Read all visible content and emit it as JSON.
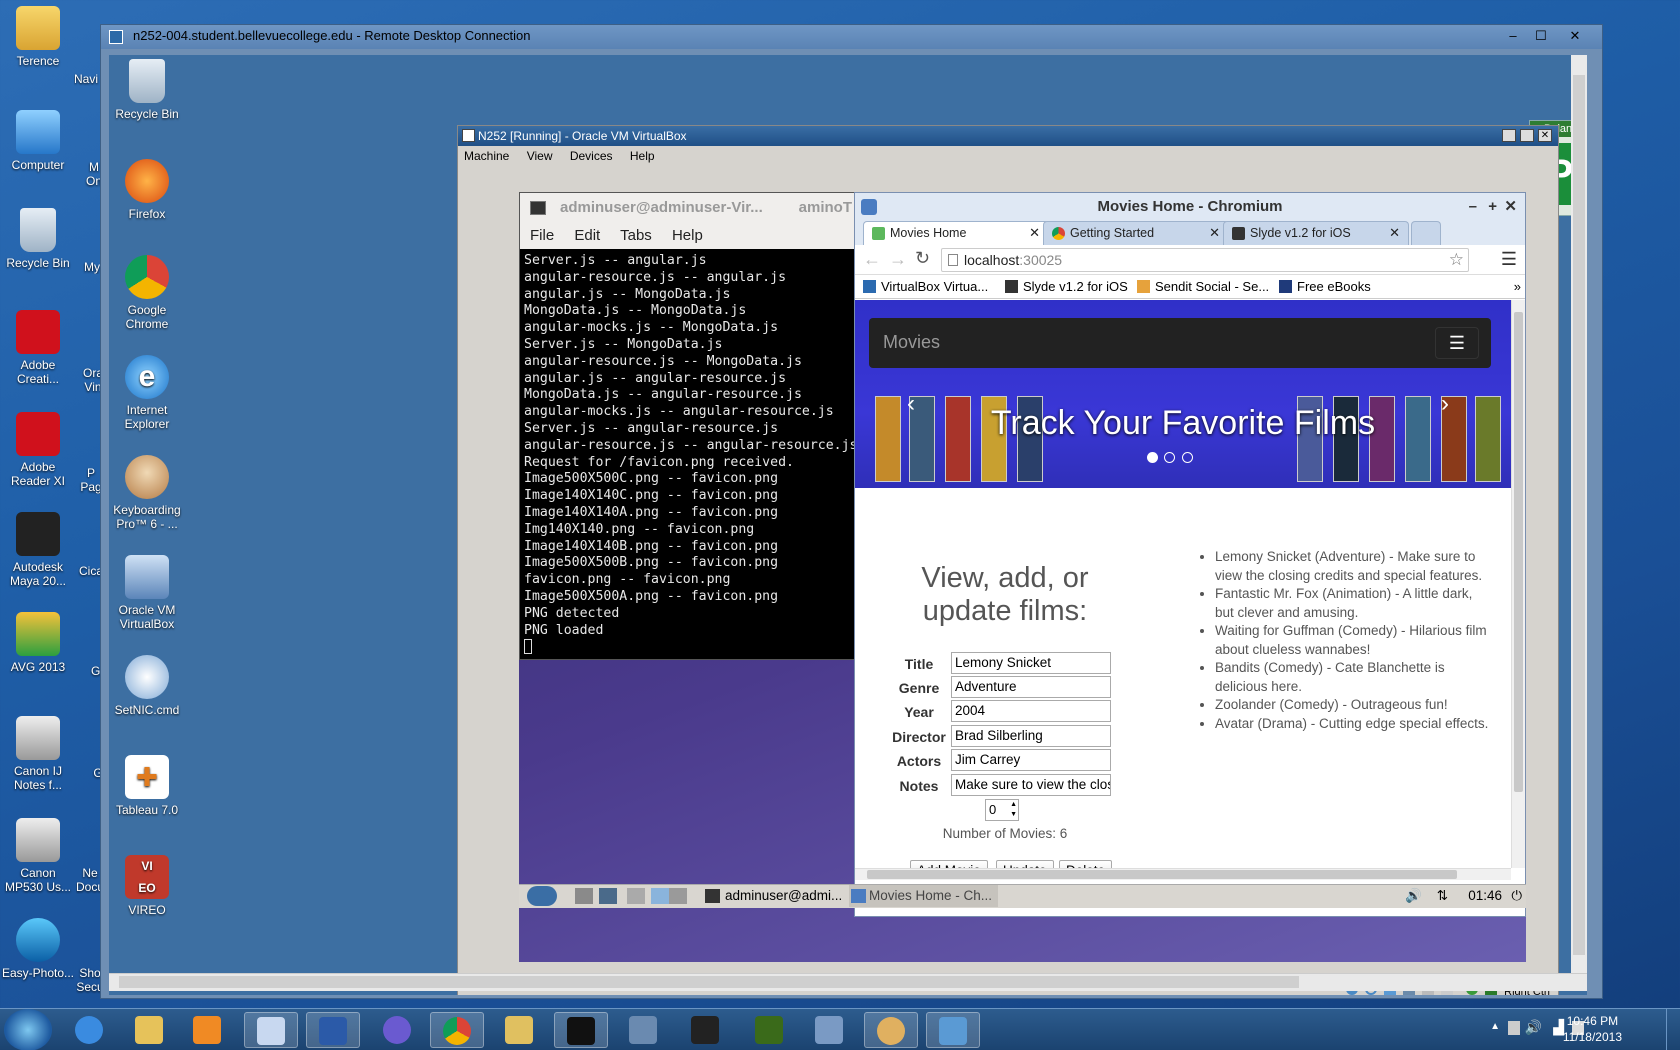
{
  "desktop_icons": [
    {
      "label": "Terence",
      "icon": "user-folder-icon"
    },
    {
      "label": "Computer",
      "icon": "computer-icon"
    },
    {
      "label": "Recycle Bin",
      "icon": "recycle-bin-icon"
    },
    {
      "label": "Adobe Creati...",
      "icon": "adobe-cc-icon"
    },
    {
      "label": "Adobe Reader XI",
      "icon": "adobe-reader-icon"
    },
    {
      "label": "Autodesk Maya 20...",
      "icon": "maya-icon"
    },
    {
      "label": "AVG 2013",
      "icon": "avg-icon"
    },
    {
      "label": "Canon IJ Notes f...",
      "icon": "canon-notes-icon"
    },
    {
      "label": "Canon MP530 Us...",
      "icon": "canon-printer-icon"
    },
    {
      "label": "Easy-Photo...",
      "icon": "easy-photo-icon"
    }
  ],
  "partial_icons": [
    "Navi",
    "M On",
    "My",
    "Ora Vin",
    "P Pag",
    "Cica",
    "Gi",
    "G",
    "Ne Docu",
    "Sho Secu"
  ],
  "remote_icons": [
    {
      "label": "Recycle Bin",
      "icon": "recycle-bin-icon"
    },
    {
      "label": "Firefox",
      "icon": "firefox-icon"
    },
    {
      "label": "Google Chrome",
      "icon": "chrome-icon"
    },
    {
      "label": "Internet Explorer",
      "icon": "ie-icon"
    },
    {
      "label": "Keyboarding Pro™ 6 - ...",
      "icon": "keyboarding-icon"
    },
    {
      "label": "Oracle VM VirtualBox",
      "icon": "virtualbox-icon"
    },
    {
      "label": "SetNIC.cmd",
      "icon": "cmd-icon"
    },
    {
      "label": "Tableau 7.0",
      "icon": "tableau-icon"
    },
    {
      "label": "VIREO",
      "icon": "vireo-icon"
    }
  ],
  "rdp": {
    "title": "n252-004.student.bellevuecollege.edu - Remote Desktop Connection"
  },
  "side_panel": {
    "label": "Balanc"
  },
  "vbox": {
    "title": "N252 [Running] - Oracle VM VirtualBox",
    "menu": [
      "Machine",
      "View",
      "Devices",
      "Help"
    ],
    "status_text": "Right Ctrl"
  },
  "terminal": {
    "title": "adminuser@adminuser-Vir...",
    "title_tail": "aminoT",
    "menu": [
      "File",
      "Edit",
      "Tabs",
      "Help"
    ],
    "lines": [
      "Server.js -- angular.js",
      "angular-resource.js -- angular.js",
      "angular.js -- MongoData.js",
      "MongoData.js -- MongoData.js",
      "angular-mocks.js -- MongoData.js",
      "Server.js -- MongoData.js",
      "angular-resource.js -- MongoData.js",
      "angular.js -- angular-resource.js",
      "MongoData.js -- angular-resource.js",
      "angular-mocks.js -- angular-resource.js",
      "Server.js -- angular-resource.js",
      "angular-resource.js -- angular-resource.js",
      "Request for /favicon.png received.",
      "Image500X500C.png -- favicon.png",
      "Image140X140C.png -- favicon.png",
      "Image140X140A.png -- favicon.png",
      "Img140X140.png -- favicon.png",
      "Image140X140B.png -- favicon.png",
      "Image500X500B.png -- favicon.png",
      "favicon.png -- favicon.png",
      "Image500X500A.png -- favicon.png",
      "PNG detected",
      "PNG loaded"
    ]
  },
  "chromium": {
    "title": "Movies Home - Chromium",
    "tabs": [
      {
        "label": "Movies Home",
        "active": true
      },
      {
        "label": "Getting Started",
        "active": false
      },
      {
        "label": "Slyde v1.2 for iOS",
        "active": false
      }
    ],
    "address": "localhost",
    "port": ":30025",
    "bookmarks": [
      "VirtualBox Virtua...",
      "Slyde v1.2 for iOS",
      "Sendit Social - Se...",
      "Free eBooks"
    ],
    "bookmarks_more": "»"
  },
  "movies_page": {
    "brand": "Movies",
    "carousel_caption": "Track Your Favorite Films",
    "form_heading": "View, add, or update films:",
    "fields": [
      {
        "label": "Title",
        "value": "Lemony Snicket"
      },
      {
        "label": "Genre",
        "value": "Adventure"
      },
      {
        "label": "Year",
        "value": "2004"
      },
      {
        "label": "Director",
        "value": "Brad Silberling"
      },
      {
        "label": "Actors",
        "value": "Jim Carrey"
      },
      {
        "label": "Notes",
        "value": "Make sure to view the closi"
      }
    ],
    "index_value": "0",
    "movie_count": "Number of Movies: 6",
    "buttons": [
      "Add Movie",
      "Update",
      "Delete"
    ],
    "reviews": [
      "Lemony Snicket (Adventure) - Make sure to view the closing credits and special features.",
      "Fantastic Mr. Fox (Animation) - A little dark, but clever and amusing.",
      "Waiting for Guffman (Comedy) - Hilarious film about clueless wannabes!",
      "Bandits (Comedy) - Cate Blanchette is delicious here.",
      "Zoolander (Comedy) - Outrageous fun!",
      "Avatar (Drama) - Cutting edge special effects."
    ]
  },
  "guest_taskbar": {
    "items": [
      "adminuser@admi...",
      "Movies Home - Ch..."
    ],
    "time": "01:46"
  },
  "host_taskbar": {
    "time": "10:46 PM",
    "date": "11/18/2013"
  }
}
